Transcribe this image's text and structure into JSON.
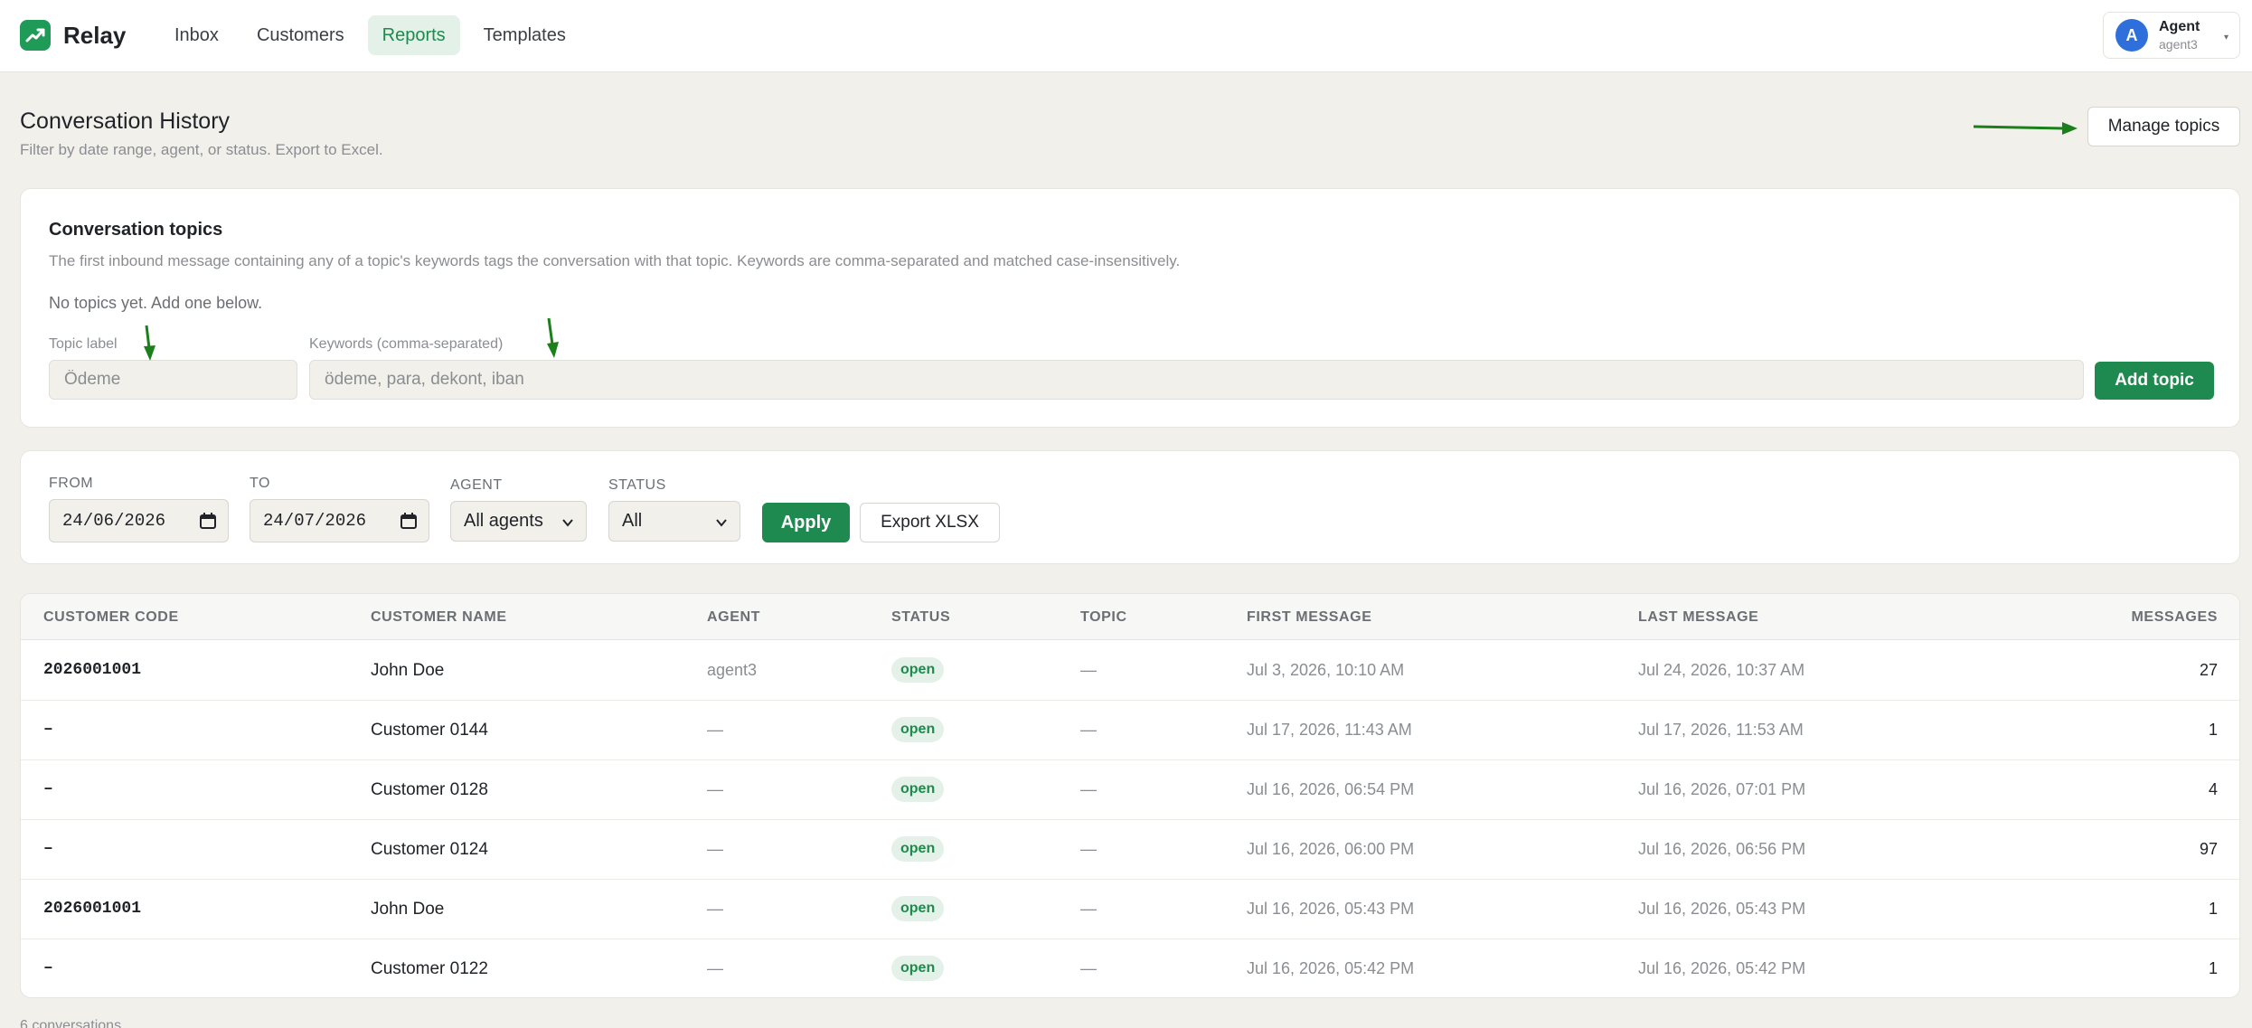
{
  "app": {
    "name": "Relay",
    "accent": "#1f8a4f"
  },
  "nav": {
    "items": [
      {
        "label": "Inbox",
        "active": false
      },
      {
        "label": "Customers",
        "active": false
      },
      {
        "label": "Reports",
        "active": true
      },
      {
        "label": "Templates",
        "active": false
      }
    ]
  },
  "user": {
    "initial": "A",
    "name": "Agent",
    "handle": "agent3"
  },
  "page": {
    "title": "Conversation History",
    "subtitle": "Filter by date range, agent, or status. Export to Excel.",
    "manage_topics_label": "Manage topics"
  },
  "topics": {
    "title": "Conversation topics",
    "description": "The first inbound message containing any of a topic's keywords tags the conversation with that topic. Keywords are comma-separated and matched case-insensitively.",
    "empty_text": "No topics yet. Add one below.",
    "label_field": {
      "label": "Topic label",
      "placeholder": "Ödeme",
      "value": ""
    },
    "keywords_field": {
      "label": "Keywords (comma-separated)",
      "placeholder": "ödeme, para, dekont, iban",
      "value": ""
    },
    "add_label": "Add topic"
  },
  "filters": {
    "from": {
      "label": "FROM",
      "value": "24/06/2026"
    },
    "to": {
      "label": "TO",
      "value": "24/07/2026"
    },
    "agent": {
      "label": "AGENT",
      "value": "All agents"
    },
    "status": {
      "label": "STATUS",
      "value": "All"
    },
    "apply_label": "Apply",
    "export_label": "Export XLSX"
  },
  "table": {
    "columns": {
      "code": "CUSTOMER CODE",
      "name": "CUSTOMER NAME",
      "agent": "AGENT",
      "status": "STATUS",
      "topic": "TOPIC",
      "first": "FIRST MESSAGE",
      "last": "LAST MESSAGE",
      "messages": "MESSAGES"
    },
    "rows": [
      {
        "code": "2026001001",
        "name": "John Doe",
        "agent": "agent3",
        "status": "open",
        "topic": "—",
        "first": "Jul 3, 2026, 10:10 AM",
        "last": "Jul 24, 2026, 10:37 AM",
        "messages": "27"
      },
      {
        "code": "–",
        "name": "Customer 0144",
        "agent": "—",
        "status": "open",
        "topic": "—",
        "first": "Jul 17, 2026, 11:43 AM",
        "last": "Jul 17, 2026, 11:53 AM",
        "messages": "1"
      },
      {
        "code": "–",
        "name": "Customer 0128",
        "agent": "—",
        "status": "open",
        "topic": "—",
        "first": "Jul 16, 2026, 06:54 PM",
        "last": "Jul 16, 2026, 07:01 PM",
        "messages": "4"
      },
      {
        "code": "–",
        "name": "Customer 0124",
        "agent": "—",
        "status": "open",
        "topic": "—",
        "first": "Jul 16, 2026, 06:00 PM",
        "last": "Jul 16, 2026, 06:56 PM",
        "messages": "97"
      },
      {
        "code": "2026001001",
        "name": "John Doe",
        "agent": "—",
        "status": "open",
        "topic": "—",
        "first": "Jul 16, 2026, 05:43 PM",
        "last": "Jul 16, 2026, 05:43 PM",
        "messages": "1"
      },
      {
        "code": "–",
        "name": "Customer 0122",
        "agent": "—",
        "status": "open",
        "topic": "—",
        "first": "Jul 16, 2026, 05:42 PM",
        "last": "Jul 16, 2026, 05:42 PM",
        "messages": "1"
      }
    ],
    "footer": "6 conversations"
  },
  "icons": {
    "logo": "chart-trend-icon",
    "calendar": "calendar-icon",
    "chevron": "chevron-down-icon",
    "annotation_arrow": "arrow-icon"
  }
}
